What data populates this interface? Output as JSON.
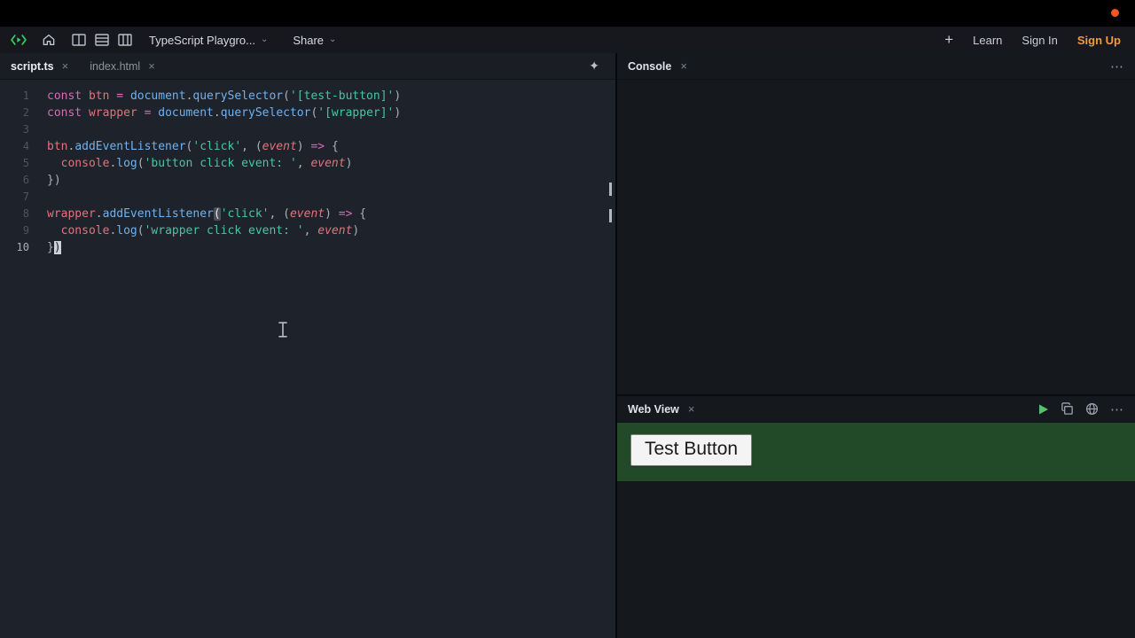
{
  "system_bar": {
    "recording_indicator_color": "#f2571f"
  },
  "header": {
    "project_title": "TypeScript Playgro...",
    "share_label": "Share",
    "learn_label": "Learn",
    "sign_in_label": "Sign In",
    "sign_up_label": "Sign Up",
    "sign_up_color": "#f09a42",
    "logo_color": "#3ecf63"
  },
  "icons": {
    "close": "×",
    "chevron_down": "⌄",
    "plus": "+",
    "menu": "⋯",
    "sparkles": "✦"
  },
  "editor": {
    "tabs": [
      {
        "label": "script.ts"
      },
      {
        "label": "index.html"
      }
    ],
    "active_tab": "script.ts",
    "cursor_line": 10,
    "code_lines": [
      [
        {
          "t": "const",
          "c": "k"
        },
        {
          "t": " ",
          "c": "t"
        },
        {
          "t": "btn",
          "c": "v"
        },
        {
          "t": " ",
          "c": "t"
        },
        {
          "t": "=",
          "c": "k"
        },
        {
          "t": " ",
          "c": "t"
        },
        {
          "t": "document",
          "c": "f"
        },
        {
          "t": ".",
          "c": "p"
        },
        {
          "t": "querySelector",
          "c": "f"
        },
        {
          "t": "(",
          "c": "p"
        },
        {
          "t": "'[test-button]'",
          "c": "s"
        },
        {
          "t": ")",
          "c": "p"
        }
      ],
      [
        {
          "t": "const",
          "c": "k"
        },
        {
          "t": " ",
          "c": "t"
        },
        {
          "t": "wrapper",
          "c": "v"
        },
        {
          "t": " ",
          "c": "t"
        },
        {
          "t": "=",
          "c": "k"
        },
        {
          "t": " ",
          "c": "t"
        },
        {
          "t": "document",
          "c": "f"
        },
        {
          "t": ".",
          "c": "p"
        },
        {
          "t": "querySelector",
          "c": "f"
        },
        {
          "t": "(",
          "c": "p"
        },
        {
          "t": "'[wrapper]'",
          "c": "s"
        },
        {
          "t": ")",
          "c": "p"
        }
      ],
      [],
      [
        {
          "t": "btn",
          "c": "v"
        },
        {
          "t": ".",
          "c": "p"
        },
        {
          "t": "addEventListener",
          "c": "f"
        },
        {
          "t": "(",
          "c": "p"
        },
        {
          "t": "'click'",
          "c": "s"
        },
        {
          "t": ", ",
          "c": "p"
        },
        {
          "t": "(",
          "c": "p"
        },
        {
          "t": "event",
          "c": "i"
        },
        {
          "t": ")",
          "c": "p"
        },
        {
          "t": " ",
          "c": "t"
        },
        {
          "t": "=>",
          "c": "k"
        },
        {
          "t": " ",
          "c": "t"
        },
        {
          "t": "{",
          "c": "p"
        }
      ],
      [
        {
          "t": "  ",
          "c": "t"
        },
        {
          "t": "console",
          "c": "v"
        },
        {
          "t": ".",
          "c": "p"
        },
        {
          "t": "log",
          "c": "f"
        },
        {
          "t": "(",
          "c": "p"
        },
        {
          "t": "'button click event: '",
          "c": "s"
        },
        {
          "t": ", ",
          "c": "p"
        },
        {
          "t": "event",
          "c": "i"
        },
        {
          "t": ")",
          "c": "p"
        }
      ],
      [
        {
          "t": "})",
          "c": "p"
        }
      ],
      [],
      [
        {
          "t": "wrapper",
          "c": "v"
        },
        {
          "t": ".",
          "c": "p"
        },
        {
          "t": "addEventListener",
          "c": "f"
        },
        {
          "t": "(",
          "c": "m"
        },
        {
          "t": "'click'",
          "c": "s"
        },
        {
          "t": ", ",
          "c": "p"
        },
        {
          "t": "(",
          "c": "p"
        },
        {
          "t": "event",
          "c": "i"
        },
        {
          "t": ")",
          "c": "p"
        },
        {
          "t": " ",
          "c": "t"
        },
        {
          "t": "=>",
          "c": "k"
        },
        {
          "t": " ",
          "c": "t"
        },
        {
          "t": "{",
          "c": "p"
        }
      ],
      [
        {
          "t": "  ",
          "c": "t"
        },
        {
          "t": "console",
          "c": "v"
        },
        {
          "t": ".",
          "c": "p"
        },
        {
          "t": "log",
          "c": "f"
        },
        {
          "t": "(",
          "c": "p"
        },
        {
          "t": "'wrapper click event: '",
          "c": "s"
        },
        {
          "t": ", ",
          "c": "p"
        },
        {
          "t": "event",
          "c": "i"
        },
        {
          "t": ")",
          "c": "p"
        }
      ],
      [
        {
          "t": "}",
          "c": "p"
        },
        {
          "t": ")",
          "c": "c"
        }
      ]
    ]
  },
  "console_panel": {
    "title": "Console"
  },
  "webview_panel": {
    "title": "Web View",
    "test_button_label": "Test Button",
    "wrapper_background": "#234a28"
  },
  "syntax_colors": {
    "keyword": "#d66cb6",
    "variable": "#e3737e",
    "function": "#6db2f2",
    "string": "#45c6a8",
    "punctuation": "#a9b1bd",
    "line_number": "#4d5565"
  }
}
